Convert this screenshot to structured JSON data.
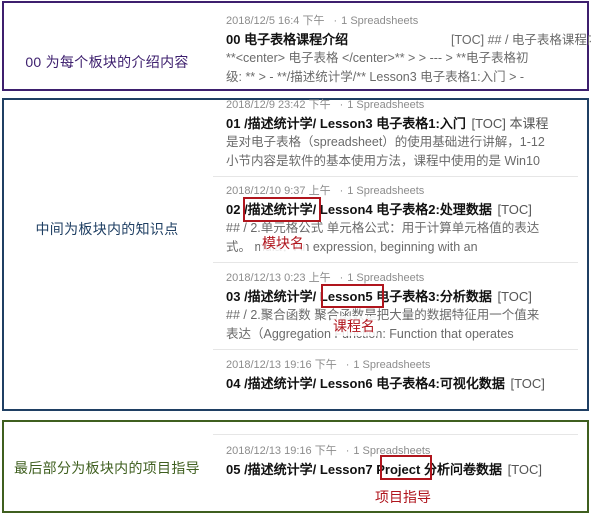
{
  "sections": {
    "intro_label": "00 为每个板块的介绍内容",
    "topics_label": "中间为板块内的知识点",
    "project_label": "最后部分为板块内的项目指导"
  },
  "entries": [
    {
      "date": "2018/12/5 16:4 下午",
      "category": "1 Spreadsheets",
      "title": "00 电子表格课程介绍",
      "toc": "",
      "excerpt": [
        "[TOC] ## / 电子表格课程内容 >",
        "**<center> 电子表格 </center>** > > --- > **电子表格初",
        "级: ** > - **/描述统计学/** Lesson3 电子表格1:入门 > -"
      ]
    },
    {
      "date": "2018/12/9 23:42 下午",
      "category": "1 Spreadsheets",
      "title": "01 /描述统计学/ Lesson3 电子表格1:入门",
      "toc": "[TOC] 本课程",
      "excerpt": [
        "是对电子表格（spreadsheet）的使用基础进行讲解，1-12",
        "小节内容是软件的基本使用方法，课程中使用的是 Win10"
      ]
    },
    {
      "date": "2018/12/10 9:37 上午",
      "category": "1 Spreadsheets",
      "title": "02 /描述统计学/ Lesson4 电子表格2:处理数据",
      "toc": "[TOC]",
      "excerpt": [
        "## / 2.单元格公式  单元格公式：用于计算单元格值的表达",
        "式。        mula：An expression, beginning with an"
      ]
    },
    {
      "date": "2018/12/13 0:23 上午",
      "category": "1 Spreadsheets",
      "title": "03 /描述统计学/ Lesson5 电子表格3:分析数据",
      "toc": "[TOC]",
      "excerpt": [
        "## / 2.聚合函数  聚合函数是把大量的数据特征用一个值来",
        "表达（Aggregation Function: Function that operates"
      ]
    },
    {
      "date": "2018/12/13 19:16 下午",
      "category": "1 Spreadsheets",
      "title": "04 /描述统计学/ Lesson6 电子表格4:可视化数据",
      "toc": "[TOC]",
      "excerpt": []
    },
    {
      "date": "2018/12/13 19:16 下午",
      "category": "1 Spreadsheets",
      "title": "05 /描述统计学/ Lesson7 Project 分析问卷数据",
      "toc": "[TOC]",
      "excerpt": []
    }
  ],
  "annotations": {
    "module_name": "模块名",
    "course_name": "课程名",
    "project_guide": "项目指导"
  },
  "colors": {
    "intro_frame": "#3d1f6e",
    "topics_frame": "#1f3f63",
    "project_frame": "#3f5f1f",
    "highlight": "#b0151d"
  }
}
